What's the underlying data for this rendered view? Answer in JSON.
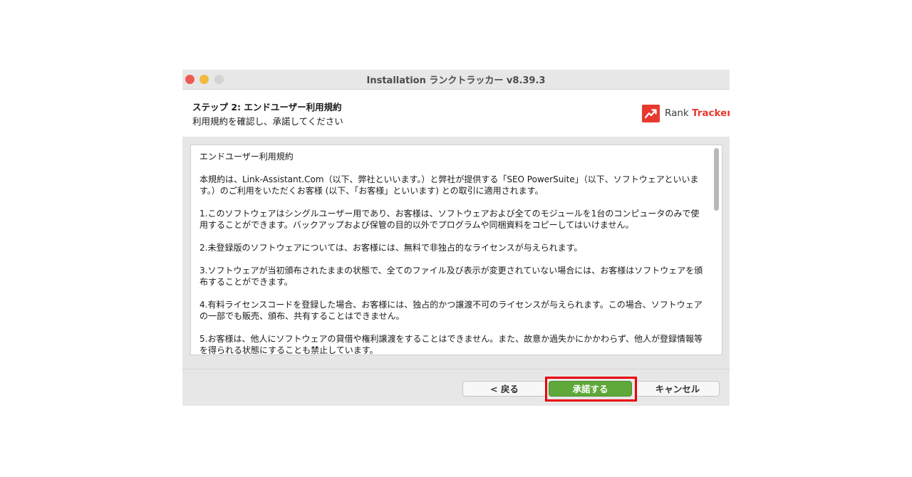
{
  "window": {
    "title": "Installation ランクトラッカー v8.39.3"
  },
  "header": {
    "step_title": "ステップ 2: エンドユーザー利用規約",
    "step_subtitle": "利用規約を確認し、承諾してください",
    "logo_text_prefix": "Rank ",
    "logo_text_accent": "Tracker"
  },
  "agreement": {
    "heading": "エンドユーザー利用規約",
    "paragraphs": [
      "本規約は、Link-Assistant.Com（以下、弊社といいます。）と弊社が提供する「SEO PowerSuite」（以下、ソフトウェアといいます。）のご利用をいただくお客様 (以下、「お客様」といいます) との取引に適用されます。",
      "1.このソフトウェアはシングルユーザー用であり、お客様は、ソフトウェアおよび全てのモジュールを1台のコンピュータのみで使用することができます。バックアップおよび保管の目的以外でプログラムや同梱資料をコピーしてはいけません。",
      "2.未登録版のソフトウェアについては、お客様には、無料で非独占的なライセンスが与えられます。",
      "3.ソフトウェアが当初頒布されたままの状態で、全てのファイル及び表示が変更されていない場合には、お客様はソフトウェアを頒布することができます。",
      "4.有料ライセンスコードを登録した場合、お客様には、独占的かつ譲渡不可のライセンスが与えられます。この場合、ソフトウェアの一部でも販売、頒布、共有することはできません。",
      "5.お客様は、他人にソフトウェアの貸借や権利譲渡をすることはできません。また、故意か過失かにかかわらず、他人が登録情報等を得られる状態にすることも禁止しています。"
    ]
  },
  "footer": {
    "back_label": "< 戻る",
    "accept_label": "承諾する",
    "cancel_label": "キャンセル"
  },
  "colors": {
    "accent_red": "#e8392f",
    "accept_green": "#5fa83a",
    "highlight_red": "#e8000a"
  }
}
